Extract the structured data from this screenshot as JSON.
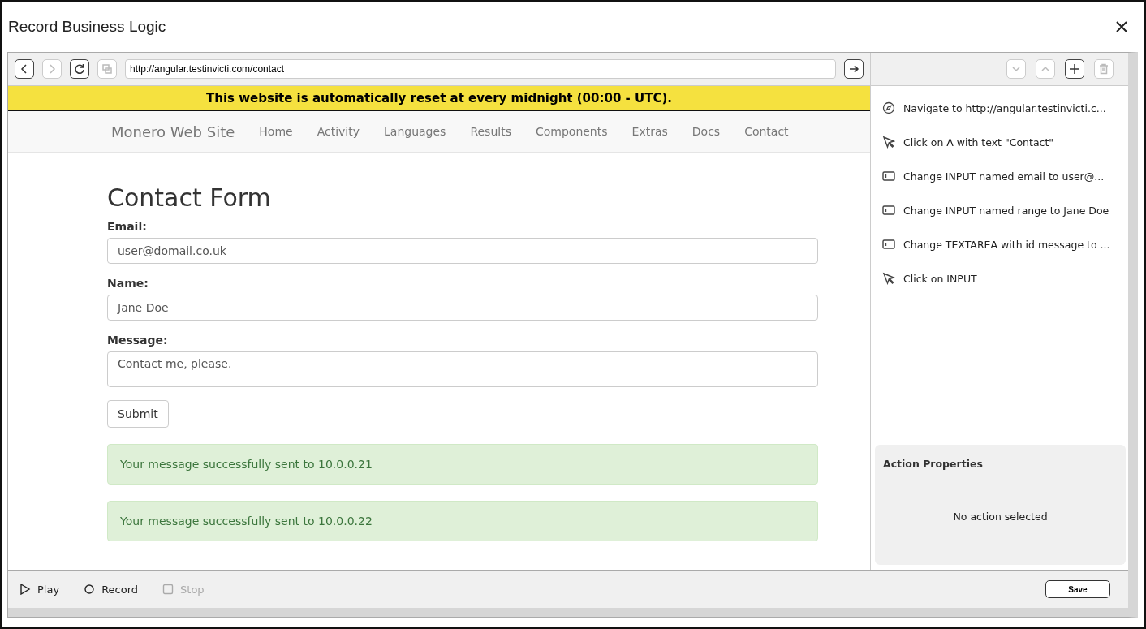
{
  "window": {
    "title": "Record Business Logic"
  },
  "browser": {
    "nav_buttons": [
      {
        "kind": "back",
        "disabled": false
      },
      {
        "kind": "forward",
        "disabled": true
      },
      {
        "kind": "reload",
        "disabled": false
      },
      {
        "kind": "copy",
        "disabled": true
      }
    ],
    "url": "http://angular.testinvicti.com/contact"
  },
  "banner": "This website is automatically reset at every midnight (00:00 - UTC).",
  "site": {
    "brand": "Monero Web Site",
    "nav": [
      "Home",
      "Activity",
      "Languages",
      "Results",
      "Components",
      "Extras",
      "Docs",
      "Contact"
    ],
    "form_title": "Contact Form",
    "fields": [
      {
        "label": "Email:",
        "value": "user@domail.co.uk",
        "kind": "input"
      },
      {
        "label": "Name:",
        "value": "Jane Doe",
        "kind": "input"
      },
      {
        "label": "Message:",
        "value": "Contact me, please.",
        "kind": "textarea"
      }
    ],
    "submit": "Submit",
    "alerts": [
      "Your message successfully sent to 10.0.0.21",
      "Your message successfully sent to 10.0.0.22"
    ]
  },
  "actions_toolbar": [
    {
      "kind": "down",
      "disabled": true
    },
    {
      "kind": "up",
      "disabled": true
    },
    {
      "kind": "add",
      "disabled": false
    },
    {
      "kind": "delete",
      "disabled": true
    }
  ],
  "actions": [
    {
      "kind": "navigate",
      "text": "Navigate to http://angular.testinvicti.c..."
    },
    {
      "kind": "click",
      "text": "Click on A with text \"Contact\""
    },
    {
      "kind": "change",
      "text": "Change INPUT named email to user@..."
    },
    {
      "kind": "change",
      "text": "Change INPUT named range to Jane Doe"
    },
    {
      "kind": "change",
      "text": "Change TEXTAREA with id message to ..."
    },
    {
      "kind": "click",
      "text": "Click on INPUT"
    }
  ],
  "properties": {
    "title": "Action Properties",
    "empty": "No action selected"
  },
  "controls": [
    {
      "kind": "play",
      "label": "Play",
      "disabled": false
    },
    {
      "kind": "record",
      "label": "Record",
      "disabled": false
    },
    {
      "kind": "stop",
      "label": "Stop",
      "disabled": true
    }
  ],
  "save": "Save"
}
